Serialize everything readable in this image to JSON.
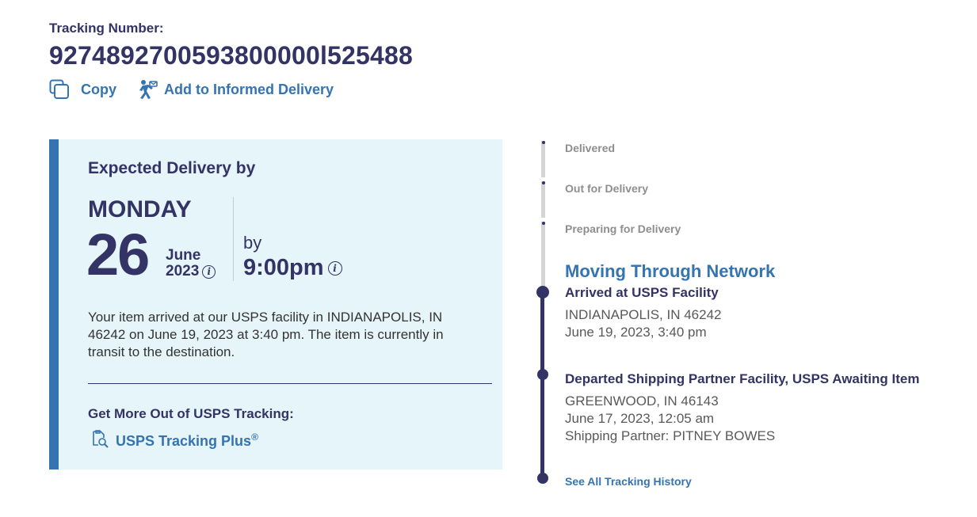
{
  "header": {
    "tracking_label": "Tracking Number:",
    "tracking_number": "9274892700593800000l525488",
    "copy_label": "Copy",
    "informed_delivery_label": "Add to Informed Delivery"
  },
  "delivery": {
    "title": "Expected Delivery by",
    "day_of_week": "MONDAY",
    "day": "26",
    "month": "June",
    "year": "2023",
    "by_label": "by",
    "time": "9:00pm",
    "status_text": "Your item arrived at our USPS facility in INDIANAPOLIS, IN 46242 on June 19, 2023 at 3:40 pm. The item is currently in transit to the destination.",
    "more_title": "Get More Out of USPS Tracking:",
    "plus_link": "USPS Tracking Plus",
    "plus_sup": "®"
  },
  "timeline": {
    "stages": [
      "Delivered",
      "Out for Delivery",
      "Preparing for Delivery"
    ],
    "current_stage": "Moving Through Network",
    "events": [
      {
        "title": "Arrived at USPS Facility",
        "lines": [
          "INDIANAPOLIS, IN 46242",
          "June 19, 2023, 3:40 pm"
        ]
      },
      {
        "title": "Departed Shipping Partner Facility, USPS Awaiting Item",
        "lines": [
          "GREENWOOD, IN 46143",
          "June 17, 2023, 12:05 am",
          "Shipping Partner: PITNEY BOWES"
        ]
      }
    ],
    "see_all": "See All Tracking History"
  },
  "colors": {
    "navy": "#333366",
    "link_blue": "#3573b1",
    "card_bg": "#e6f5f9"
  }
}
